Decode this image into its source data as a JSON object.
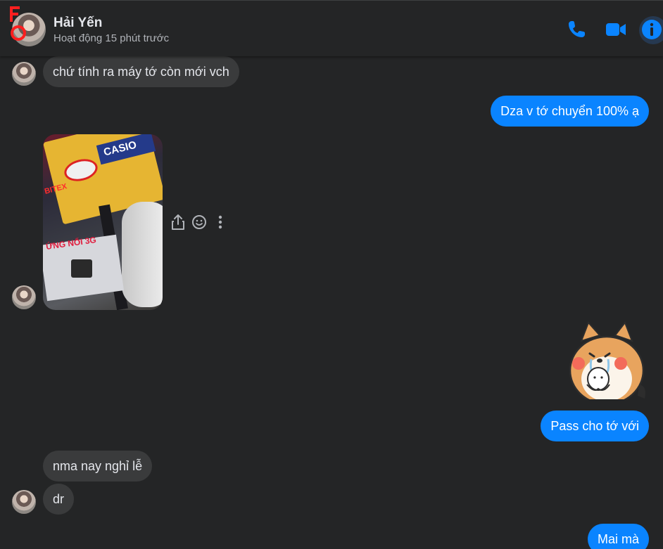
{
  "header": {
    "contact_name": "Hải Yến",
    "status": "Hoạt động 15 phút trước",
    "icons": [
      "phone-icon",
      "video-call-icon",
      "info-icon"
    ],
    "accent_color": "#0a84ff"
  },
  "messages": {
    "m1": "chứ tính ra máy tớ còn mới vch",
    "m2": "Dza v tớ chuyển 100% ạ",
    "m3": "Pass cho tớ với",
    "m4": "nma nay nghỉ lễ",
    "m5": "dr",
    "m6": "Mai mà"
  },
  "photo": {
    "brand_text": "CASIO",
    "label_text": "BITEX",
    "package_text": "ỨNG NỐI 3G"
  },
  "hover_actions": [
    "share-icon",
    "react-icon",
    "more-icon"
  ],
  "colors": {
    "background": "#242526",
    "incoming_bubble": "#3a3b3c",
    "outgoing_bubble": "#0a84ff"
  }
}
